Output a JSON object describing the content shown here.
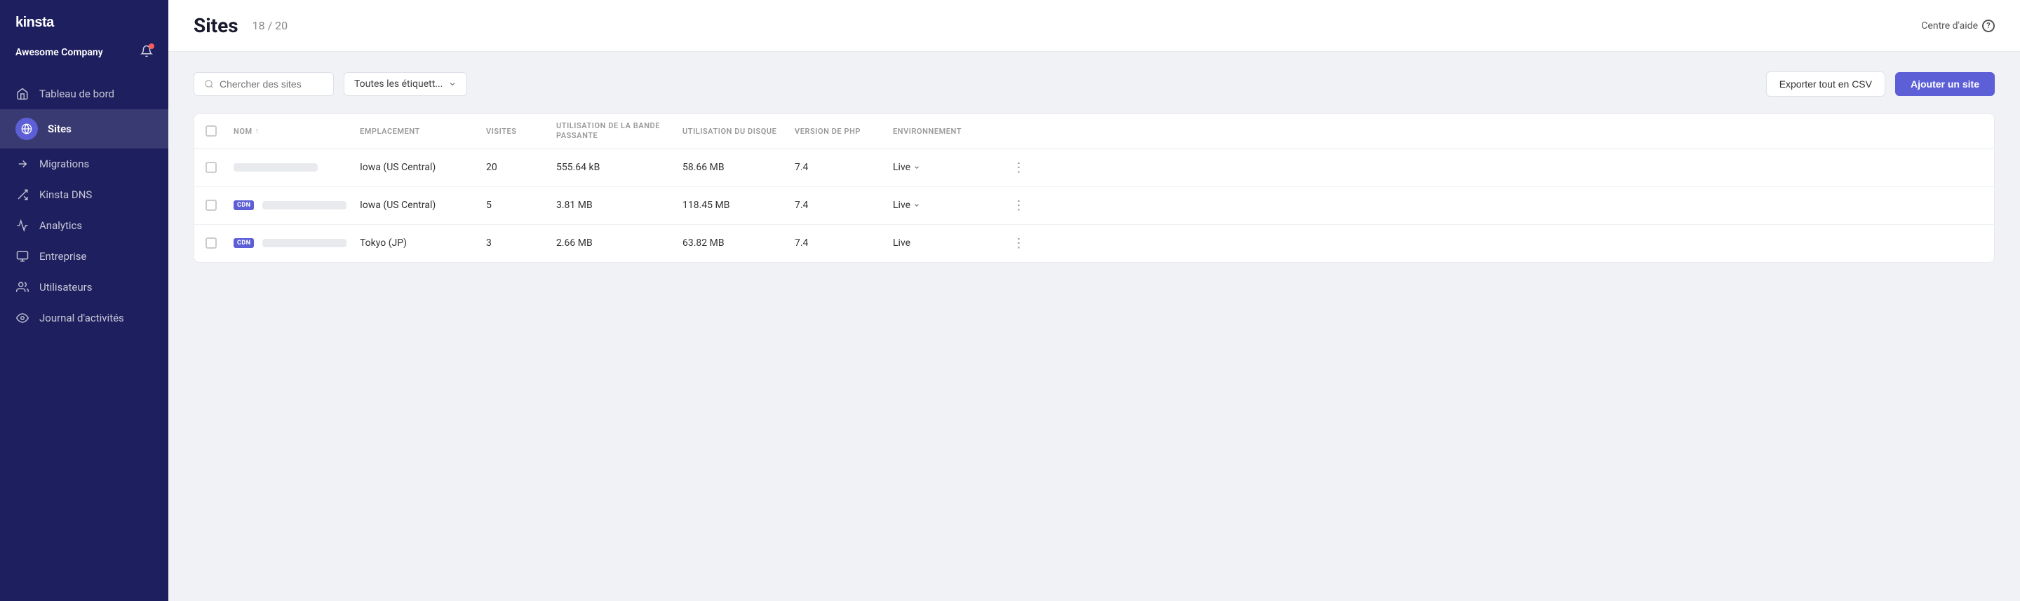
{
  "sidebar": {
    "logo": "kinsta",
    "company": "Awesome Company",
    "nav": [
      {
        "id": "dashboard",
        "label": "Tableau de bord",
        "icon": "home",
        "active": false
      },
      {
        "id": "sites",
        "label": "Sites",
        "icon": "globe",
        "active": true
      },
      {
        "id": "migrations",
        "label": "Migrations",
        "icon": "arrow-right",
        "active": false
      },
      {
        "id": "dns",
        "label": "Kinsta DNS",
        "icon": "network",
        "active": false
      },
      {
        "id": "analytics",
        "label": "Analytics",
        "icon": "chart",
        "active": false
      },
      {
        "id": "entreprise",
        "label": "Entreprise",
        "icon": "building",
        "active": false
      },
      {
        "id": "utilisateurs",
        "label": "Utilisateurs",
        "icon": "users",
        "active": false
      },
      {
        "id": "journal",
        "label": "Journal d'activités",
        "icon": "eye",
        "active": false
      }
    ]
  },
  "header": {
    "title": "Sites",
    "count": "18 / 20",
    "help": "Centre d'aide"
  },
  "toolbar": {
    "search_placeholder": "Chercher des sites",
    "filter_label": "Toutes les étiquett...",
    "export_label": "Exporter tout en CSV",
    "add_label": "Ajouter un site"
  },
  "table": {
    "columns": [
      {
        "id": "checkbox",
        "label": ""
      },
      {
        "id": "name",
        "label": "NOM"
      },
      {
        "id": "location",
        "label": "EMPLACEMENT"
      },
      {
        "id": "visits",
        "label": "VISITES"
      },
      {
        "id": "bandwidth",
        "label": "UTILISATION DE LA BANDE PASSANTE"
      },
      {
        "id": "disk",
        "label": "UTILISATION DU DISQUE"
      },
      {
        "id": "php",
        "label": "VERSION DE PHP"
      },
      {
        "id": "env",
        "label": "ENVIRONNEMENT"
      },
      {
        "id": "actions",
        "label": ""
      }
    ],
    "rows": [
      {
        "id": "row1",
        "has_cdn": false,
        "location": "Iowa (US Central)",
        "visits": "20",
        "bandwidth": "555.64 kB",
        "disk": "58.66 MB",
        "php": "7.4",
        "env": "Live"
      },
      {
        "id": "row2",
        "has_cdn": true,
        "location": "Iowa (US Central)",
        "visits": "5",
        "bandwidth": "3.81 MB",
        "disk": "118.45 MB",
        "php": "7.4",
        "env": "Live"
      },
      {
        "id": "row3",
        "has_cdn": true,
        "location": "Tokyo (JP)",
        "visits": "3",
        "bandwidth": "2.66 MB",
        "disk": "63.82 MB",
        "php": "7.4",
        "env": "Live"
      }
    ]
  }
}
